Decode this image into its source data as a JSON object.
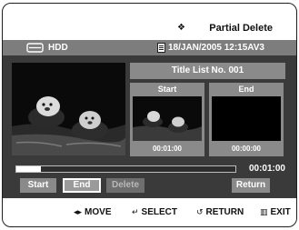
{
  "header": {
    "title": "Partial Delete",
    "title_icon": "diamond-icon"
  },
  "status": {
    "source": "HDD",
    "datetime": "18/JAN/2005 12:15AV3"
  },
  "title_list": {
    "label": "Title List No. 001"
  },
  "start_pane": {
    "label": "Start",
    "time": "00:01:00"
  },
  "end_pane": {
    "label": "End",
    "time": "00:00:00"
  },
  "progress": {
    "fraction": 0.11,
    "total_time": "00:01:00"
  },
  "buttons": {
    "start": "Start",
    "end": "End",
    "delete": "Delete",
    "return": "Return"
  },
  "hints": {
    "move": "MOVE",
    "move_icon": "◂▸",
    "select": "SELECT",
    "select_icon": "↵",
    "return": "RETURN",
    "return_icon": "↺",
    "exit": "EXIT",
    "exit_icon": "▥"
  },
  "colors": {
    "panel": "#3a3a3a",
    "pane": "#8a8a8a",
    "statusbar": "#7d7d7d"
  }
}
